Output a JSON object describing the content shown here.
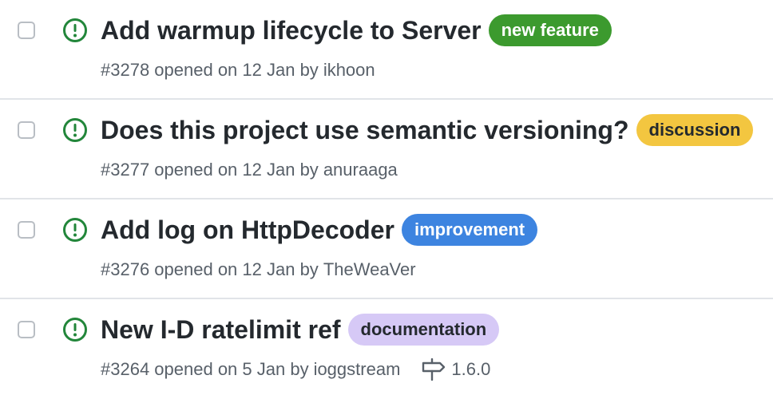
{
  "colors": {
    "open_icon": "#22863a",
    "meta_text": "#586069",
    "title_text": "#24292e"
  },
  "issues": [
    {
      "title": "Add warmup lifecycle to Server",
      "label": {
        "text": "new feature",
        "bg": "#3c9a2e",
        "fg": "#ffffff"
      },
      "meta": "#3278 opened on 12 Jan by",
      "author": "ikhoon",
      "status_icon": "issue-opened-icon"
    },
    {
      "title": "Does this project use semantic versioning?",
      "label": {
        "text": "discussion",
        "bg": "#f3c640",
        "fg": "#24292e"
      },
      "meta": "#3277 opened on 12 Jan by",
      "author": "anuraaga",
      "status_icon": "issue-opened-icon"
    },
    {
      "title": "Add log on HttpDecoder",
      "label": {
        "text": "improvement",
        "bg": "#3d84e0",
        "fg": "#ffffff"
      },
      "meta": "#3276 opened on 12 Jan by",
      "author": "TheWeaVer",
      "status_icon": "issue-opened-icon"
    },
    {
      "title": "New I-D ratelimit ref",
      "label": {
        "text": "documentation",
        "bg": "#d6c9f6",
        "fg": "#24292e"
      },
      "meta": "#3264 opened on 5 Jan by",
      "author": "ioggstream",
      "milestone": "1.6.0",
      "status_icon": "issue-opened-icon",
      "milestone_icon": "milestone-signpost-icon"
    }
  ]
}
